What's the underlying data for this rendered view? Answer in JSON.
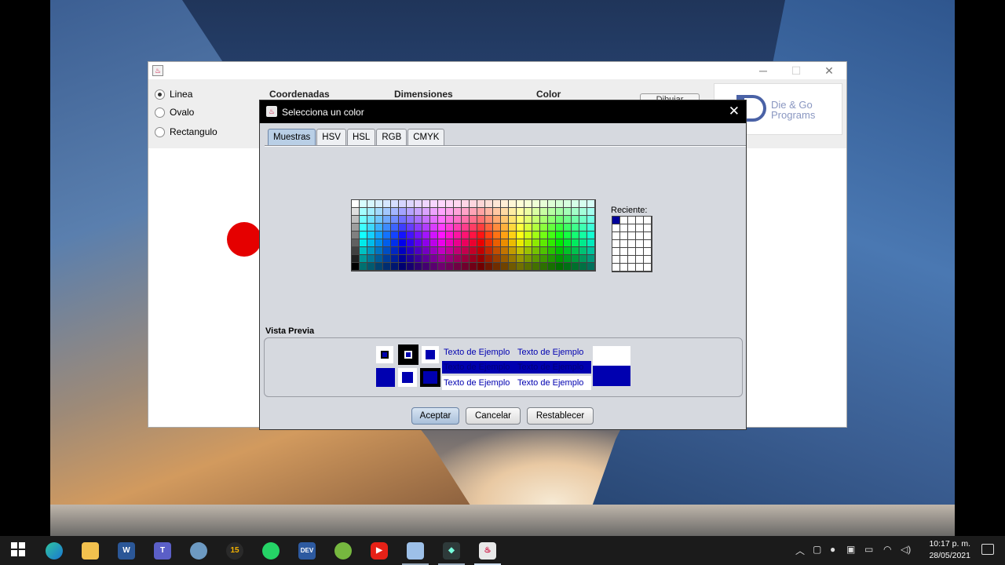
{
  "app": {
    "radios": [
      {
        "label": "Linea",
        "selected": true
      },
      {
        "label": "Ovalo",
        "selected": false
      },
      {
        "label": "Rectangulo",
        "selected": false
      }
    ],
    "labels": [
      "Coordenadas",
      "Dimensiones",
      "Color"
    ],
    "draw_button_label": "Dibujar",
    "logo_text_line1": "Die & Go",
    "logo_text_line2": "Programs",
    "shape_color": "#e50000"
  },
  "dialog": {
    "title": "Selecciona un color",
    "close_glyph": "✕",
    "tabs": [
      "Muestras",
      "HSV",
      "HSL",
      "RGB",
      "CMYK"
    ],
    "active_tab": "Muestras",
    "recent_label": "Reciente:",
    "recent_colors": [
      "#000099"
    ],
    "preview_label": "Vista Previa",
    "sample_text": "Texto de Ejemplo",
    "selected_color": "#0000b0",
    "buttons": {
      "accept": "Aceptar",
      "cancel": "Cancelar",
      "reset": "Restablecer"
    }
  },
  "taskbar": {
    "icons": [
      "windows-start",
      "edge",
      "file-explorer",
      "word",
      "teams",
      "paint",
      "app-15",
      "whatsapp",
      "dev-c",
      "utorrent",
      "youtube",
      "virtualbox",
      "netbeans",
      "java"
    ],
    "time": "10:17 p. m.",
    "date": "28/05/2021"
  }
}
